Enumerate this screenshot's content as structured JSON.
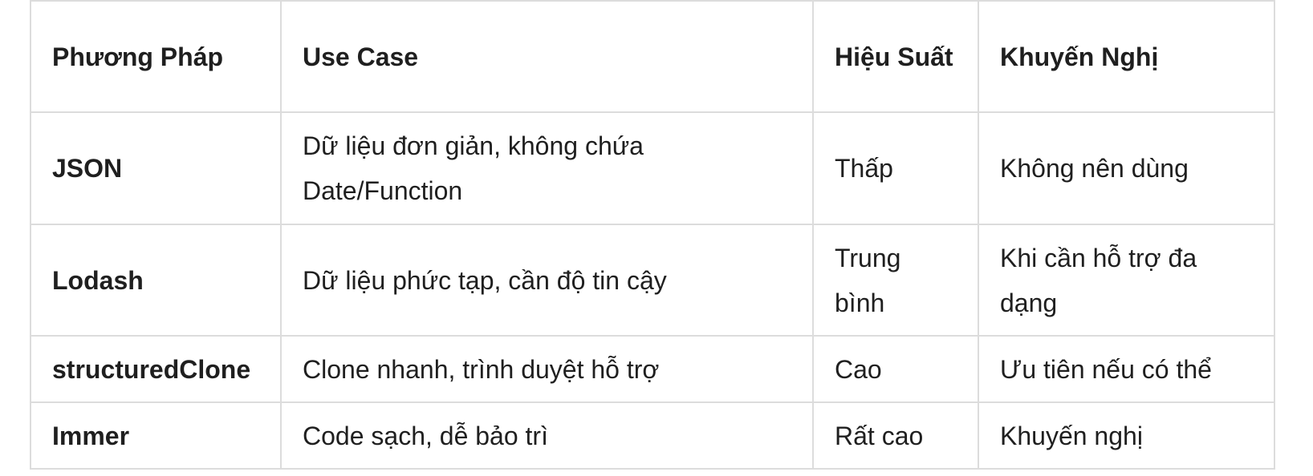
{
  "table": {
    "headers": [
      "Phương Pháp",
      "Use Case",
      "Hiệu Suất",
      "Khuyến Nghị"
    ],
    "rows": [
      {
        "method": "JSON",
        "use_case": "Dữ liệu đơn giản, không chứa Date/Function",
        "performance": "Thấp",
        "recommendation": "Không nên dùng"
      },
      {
        "method": "Lodash",
        "use_case": "Dữ liệu phức tạp, cần độ tin cậy",
        "performance": "Trung bình",
        "recommendation": "Khi cần hỗ trợ đa dạng"
      },
      {
        "method": "structuredClone",
        "use_case": "Clone nhanh, trình duyệt hỗ trợ",
        "performance": "Cao",
        "recommendation": "Ưu tiên nếu có thể"
      },
      {
        "method": "Immer",
        "use_case": "Code sạch, dễ bảo trì",
        "performance": "Rất cao",
        "recommendation": "Khuyến nghị"
      }
    ]
  }
}
